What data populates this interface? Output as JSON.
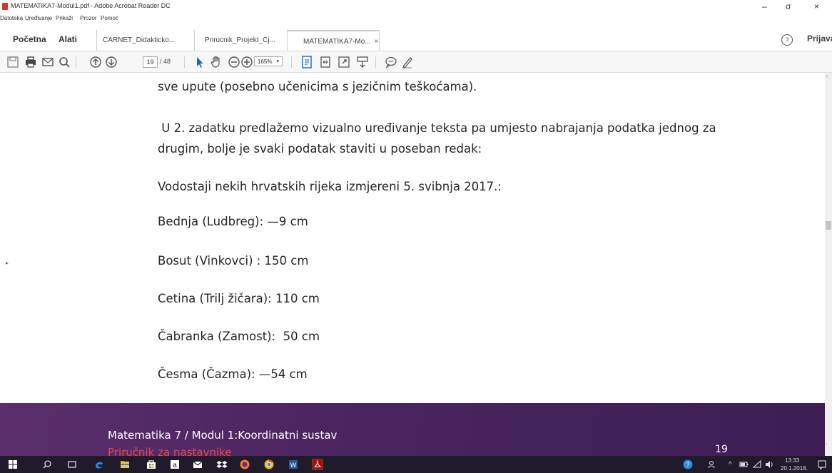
{
  "window": {
    "title": "MATEMATIKA7-Modul1.pdf - Adobe Acrobat Reader DC",
    "controls": [
      "–",
      "σ",
      "×"
    ]
  },
  "menu": [
    "Datoteka",
    "Uređivanje",
    "Prikaži",
    "Prozor",
    "Pomoć"
  ],
  "tabs": {
    "home": "Početna",
    "tools": "Alati",
    "documents": [
      {
        "label": "CARNET_Didakticko..."
      },
      {
        "label": "Prirucnik_Projekt_Cj..."
      },
      {
        "label": "MATEMATIKA7-Mo...",
        "active": true
      }
    ],
    "close_glyph": "×",
    "help_glyph": "?",
    "sign_in": "Prijava"
  },
  "toolbar": {
    "icons": [
      "save-icon",
      "print-icon",
      "email-icon",
      "search-icon",
      "page-up-icon",
      "page-down-icon",
      "select-cursor-icon",
      "hand-tool-icon",
      "zoom-out-icon",
      "zoom-in-icon",
      "fit-page-icon",
      "fit-width-icon",
      "fullscreen-icon",
      "highlight-icon",
      "comment-icon",
      "pen-icon"
    ],
    "page_current": "19",
    "page_total": "/ 48",
    "zoom": "165%",
    "zoom_dropdown_glyph": "▾"
  },
  "document": {
    "lines": [
      "sve upute (posebno učenicima s jezičnim teškoćama).",
      " U 2. zadatku predlažemo vizualno uređivanje teksta pa umjesto nabrajanja podatka jednog za",
      "drugim, bolje je svaki podatak staviti u poseban redak:",
      "Vodostaji nekih hrvatskih rijeka izmjereni 5. svibnja 2017.:",
      "Bednja (Ludbreg): —9 cm",
      "Bosut (Vinkovci) : 150 cm",
      "Cetina (Trilj žičara): 110 cm",
      "Čabranka (Zamost):  50 cm",
      "Česma (Čazma): —54 cm"
    ],
    "footer": {
      "title": "Matematika 7 / Modul 1:Koordinatni sustav",
      "subtitle": "Priručnik za nastavnike",
      "page_number": "19"
    }
  },
  "scrollbar": {
    "up_glyph": "^",
    "down_glyph": "ˇ"
  },
  "side_panel_toggle": "▸",
  "taskbar": {
    "apps": [
      "windows-start-icon",
      "search-icon",
      "task-view-icon",
      "edge-icon",
      "file-explorer-icon",
      "store-icon",
      "amazon-icon",
      "mail-icon",
      "dropbox-icon",
      "firefox-icon",
      "chrome-icon",
      "word-icon",
      "acrobat-icon"
    ],
    "tray": {
      "arrows": "^",
      "time": "13:33",
      "date": "20.1.2018."
    }
  },
  "colors": {
    "footer_band": "#4b2560",
    "footer_subtitle": "#e04a4a",
    "taskbar": "#1f1b2a",
    "acrobat_red": "#d8342a"
  }
}
